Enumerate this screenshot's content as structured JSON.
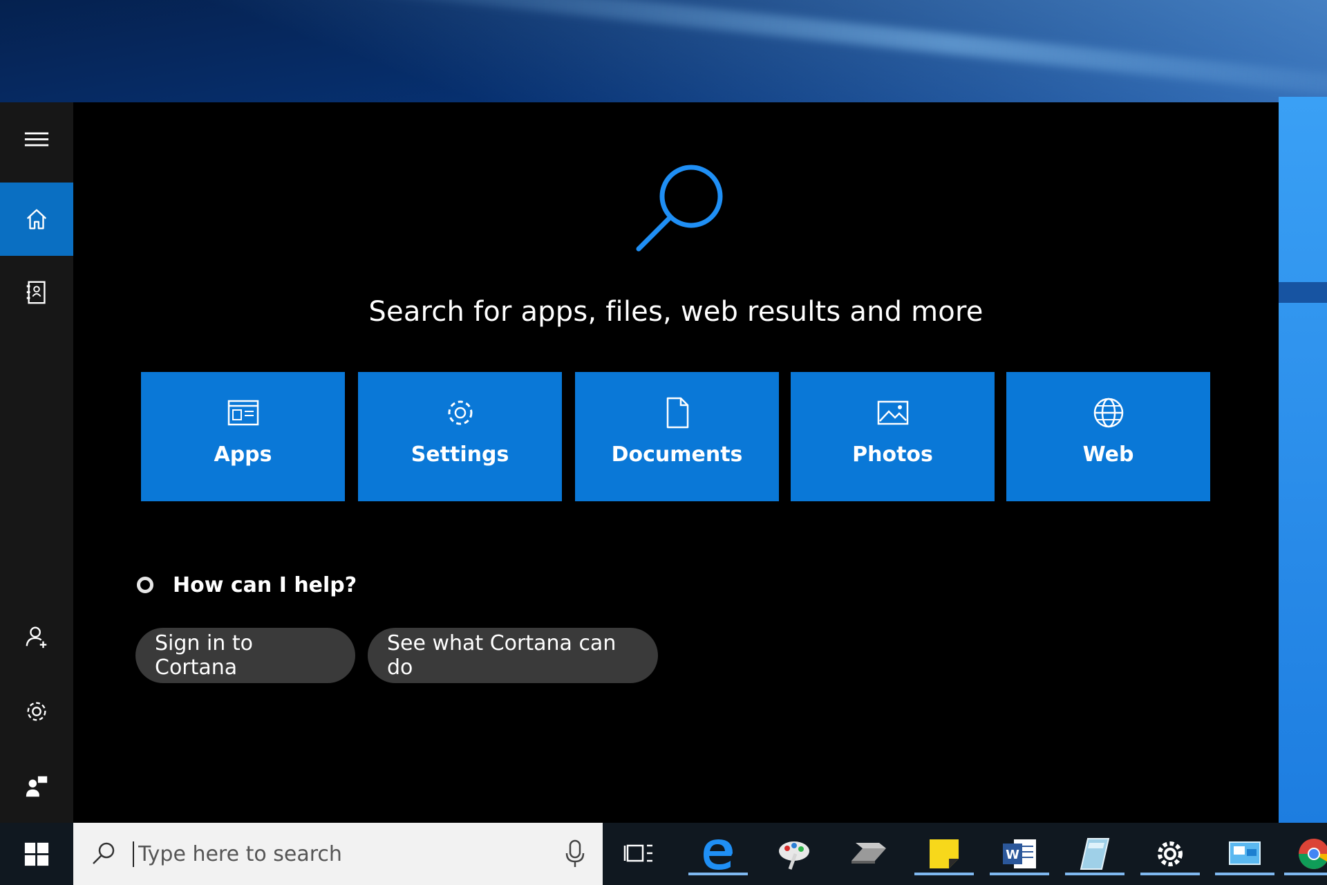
{
  "colors": {
    "panel_bg": "#000000",
    "rail_bg": "#171717",
    "accent": "#0a78d7",
    "rail_active": "#0a6fc2",
    "pill_bg": "#3a3a3a",
    "taskbar_bg": "#101820",
    "searchbox_bg": "#f2f2f2"
  },
  "rail": {
    "items": [
      {
        "icon": "hamburger-menu-icon"
      },
      {
        "icon": "home-icon",
        "active": true
      },
      {
        "icon": "notebook-icon"
      },
      {
        "icon": "add-account-icon"
      },
      {
        "icon": "gear-icon"
      },
      {
        "icon": "feedback-icon"
      }
    ]
  },
  "main": {
    "hero_icon": "magnifier-icon",
    "hero_text": "Search for apps, files, web results and more",
    "tiles": [
      {
        "icon": "apps-icon",
        "label": "Apps"
      },
      {
        "icon": "gear-icon",
        "label": "Settings"
      },
      {
        "icon": "document-icon",
        "label": "Documents"
      },
      {
        "icon": "photo-icon",
        "label": "Photos"
      },
      {
        "icon": "globe-icon",
        "label": "Web"
      }
    ],
    "help_text": "How can I help?",
    "pills": [
      {
        "label": "Sign in to Cortana"
      },
      {
        "label": "See what Cortana can do"
      }
    ]
  },
  "taskbar": {
    "start_icon": "windows-logo-icon",
    "search": {
      "placeholder": "Type here to search",
      "icon": "search-icon",
      "mic_icon": "microphone-icon"
    },
    "apps": [
      {
        "icon": "task-view-icon"
      },
      {
        "icon": "edge-icon",
        "running": true
      },
      {
        "icon": "paint-icon"
      },
      {
        "icon": "scanner-icon"
      },
      {
        "icon": "sticky-notes-icon",
        "running": true
      },
      {
        "icon": "word-icon",
        "running": true
      },
      {
        "icon": "notepad-glass-icon",
        "running": true
      },
      {
        "icon": "settings-icon",
        "running": true
      },
      {
        "icon": "remote-desktop-icon",
        "running": true
      },
      {
        "icon": "chrome-icon",
        "running": true
      }
    ]
  }
}
